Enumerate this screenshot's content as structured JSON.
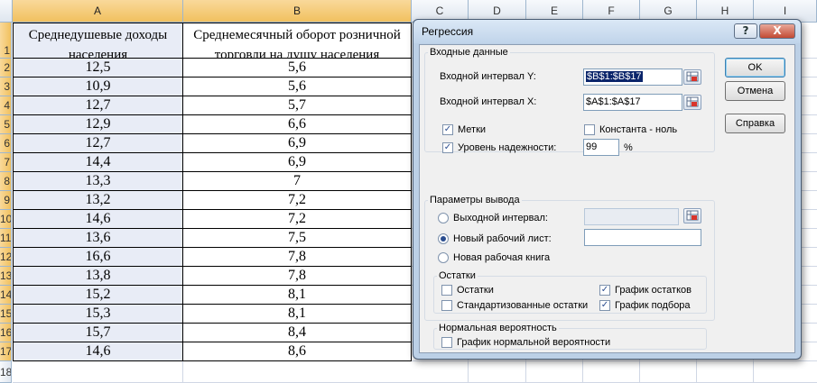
{
  "sheet": {
    "columns": [
      "A",
      "B",
      "C",
      "D",
      "E",
      "F",
      "G",
      "H",
      "I"
    ],
    "row_numbers": [
      "1",
      "2",
      "3",
      "4",
      "5",
      "6",
      "7",
      "8",
      "9",
      "10",
      "11",
      "12",
      "13",
      "14",
      "15",
      "16",
      "17",
      "18"
    ],
    "header_a": [
      "Среднедушевые доходы",
      "населения"
    ],
    "header_b": [
      "Среднемесячный оборот розничной",
      "торговли на душу населения"
    ],
    "col_a": [
      "12,5",
      "10,9",
      "12,7",
      "12,9",
      "12,7",
      "14,4",
      "13,3",
      "13,2",
      "14,6",
      "13,6",
      "16,6",
      "13,8",
      "15,2",
      "15,3",
      "15,7",
      "14,6"
    ],
    "col_b": [
      "5,6",
      "5,6",
      "5,7",
      "6,6",
      "6,9",
      "6,9",
      "7",
      "7,2",
      "7,2",
      "7,5",
      "7,8",
      "7,8",
      "8,1",
      "8,1",
      "8,4",
      "8,6"
    ]
  },
  "dialog": {
    "title": "Регрессия",
    "help_symbol": "?",
    "close_symbol": "X",
    "input_group": "Входные данные",
    "input_y_label": "Входной интервал Y:",
    "input_y_value": "$B$1:$B$17",
    "input_x_label": "Входной интервал X:",
    "input_x_value": "$A$1:$A$17",
    "labels_check": "Метки",
    "labels_checked": true,
    "constant_check": "Константа - ноль",
    "constant_checked": false,
    "confidence_check": "Уровень надежности:",
    "confidence_checked": true,
    "confidence_value": "99",
    "percent": "%",
    "output_group": "Параметры вывода",
    "output_range": "Выходной интервал:",
    "new_sheet": "Новый рабочий лист:",
    "new_book": "Новая рабочая книга",
    "selected_output": "new_sheet",
    "residuals_group": "Остатки",
    "residuals": "Остатки",
    "residuals_checked": false,
    "std_residuals": "Стандартизованные остатки",
    "std_residuals_checked": false,
    "residual_plots": "График остатков",
    "residual_plots_checked": true,
    "line_fit_plots": "График подбора",
    "line_fit_plots_checked": true,
    "normal_group": "Нормальная вероятность",
    "normal_plot": "График нормальной вероятности",
    "normal_plot_checked": false,
    "ok": "OK",
    "cancel": "Отмена",
    "help": "Справка"
  }
}
